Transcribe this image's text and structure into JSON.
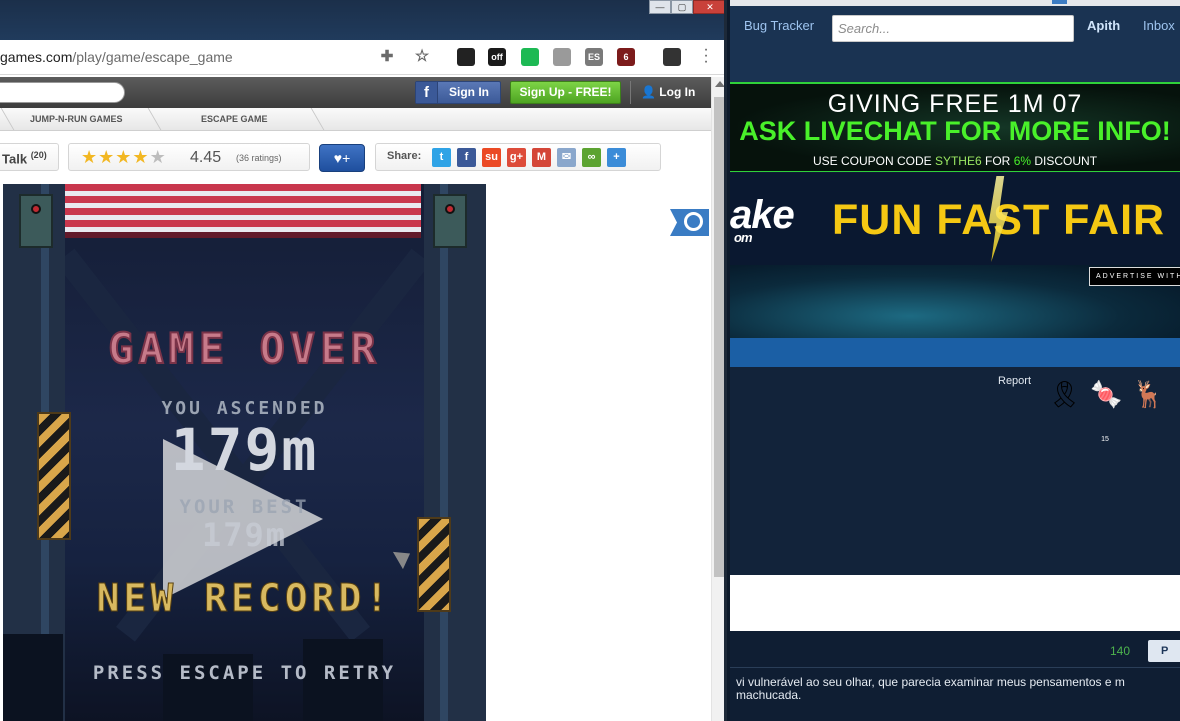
{
  "browser": {
    "url_host": "games.com",
    "url_path": "/play/game/escape_game",
    "extensions": [
      {
        "name": "puzzle-icon",
        "color": "#6b6b6b",
        "label": ""
      },
      {
        "name": "star-icon",
        "color": "#666666",
        "label": ""
      },
      {
        "name": "glasses-icon",
        "color": "#222222",
        "label": ""
      },
      {
        "name": "shm-icon",
        "color": "#1a1a1a",
        "label": "off"
      },
      {
        "name": "green-d-icon",
        "color": "#1db954",
        "label": ""
      },
      {
        "name": "dss-icon",
        "color": "#9a9a9a",
        "label": ""
      },
      {
        "name": "es-icon",
        "color": "#7a7a7a",
        "label": "ES"
      },
      {
        "name": "ublock-icon",
        "color": "#7c1b1b",
        "label": "6"
      },
      {
        "name": "profile-icon",
        "color": "#333333",
        "label": ""
      }
    ]
  },
  "site": {
    "fb_signin": "Sign In",
    "signup": "Sign Up - FREE!",
    "login": "Log In",
    "breadcrumbs": [
      "JUMP-N-RUN GAMES",
      "ESCAPE GAME"
    ],
    "talk_label": "Talk",
    "talk_count": "(20)",
    "stars_filled": 4,
    "stars_total": 5,
    "rating_value": "4.45",
    "rating_count": "(36 ratings)",
    "fav_label": "♥+",
    "share_label": "Share:",
    "share_icons": [
      {
        "name": "twitter-icon",
        "color": "#2fa3e6",
        "glyph": "t"
      },
      {
        "name": "facebook-icon",
        "color": "#3b5998",
        "glyph": "f"
      },
      {
        "name": "stumbleupon-icon",
        "color": "#eb4924",
        "glyph": "su"
      },
      {
        "name": "googleplus-icon",
        "color": "#dd4b39",
        "glyph": "g+"
      },
      {
        "name": "gmail-icon",
        "color": "#d44638",
        "glyph": "M"
      },
      {
        "name": "email-icon",
        "color": "#8aa7cc",
        "glyph": "✉"
      },
      {
        "name": "link-icon",
        "color": "#5ca331",
        "glyph": "∞"
      },
      {
        "name": "add-share-icon",
        "color": "#3b8cd8",
        "glyph": "+"
      }
    ]
  },
  "game": {
    "title": "GAME OVER",
    "ascended_label": "YOU ASCENDED",
    "score": "179m",
    "best_label": "YOUR BEST",
    "best_value": "179m",
    "record": "NEW RECORD!",
    "retry": "PRESS ESCAPE TO RETRY"
  },
  "forum": {
    "nav": {
      "bug_tracker": "Bug Tracker",
      "search_placeholder": "Search...",
      "username": "Apith",
      "inbox": "Inbox"
    },
    "banner1": {
      "line1": "GIVING FREE 1M 07",
      "line2": "ASK LIVECHAT FOR MORE INFO!",
      "line3_pre": "USE COUPON CODE",
      "line3_code": "SYTHE6",
      "line3_mid": "FOR",
      "line3_pct": "6%",
      "line3_post": "DISCOUNT"
    },
    "banner2": {
      "logo": "ake",
      "logo_sub": "om",
      "slogan": "FUN FAST FAIR"
    },
    "advertise": "ADVERTISE WITH",
    "report": "Report",
    "badges": [
      {
        "name": "ribbon-icon",
        "glyph": "🎗",
        "sub": ""
      },
      {
        "name": "candy-cane-icon",
        "glyph": "🍬",
        "sub": "15"
      },
      {
        "name": "reindeer-icon",
        "glyph": "🦌",
        "sub": ""
      }
    ],
    "footer": {
      "count": "140",
      "button": "P",
      "text_line1": "vi vulnerável ao seu olhar, que parecia examinar meus pensamentos e m",
      "text_line2": "machucada."
    }
  }
}
